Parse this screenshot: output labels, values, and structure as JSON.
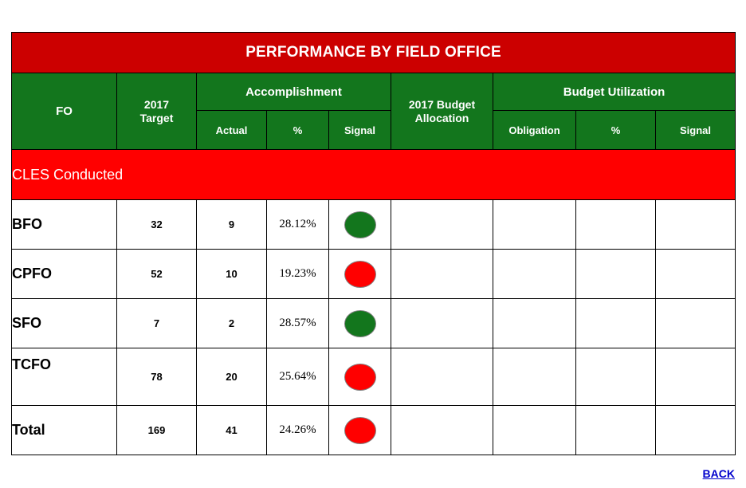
{
  "title": "PERFORMANCE BY FIELD OFFICE",
  "header": {
    "fo": "FO",
    "target": "2017\nTarget",
    "target_line1": "2017",
    "target_line2": "Target",
    "accomplishment": "Accomplishment",
    "actual": "Actual",
    "percent": "%",
    "signal": "Signal",
    "budget_allocation_line1": "2017 Budget",
    "budget_allocation_line2": "Allocation",
    "budget_utilization": "Budget Utilization",
    "obligation": "Obligation",
    "bu_percent": "%",
    "bu_signal": "Signal"
  },
  "section": {
    "label": "CLES Conducted"
  },
  "rows": [
    {
      "fo": "BFO",
      "target": "32",
      "actual": "9",
      "percent": "28.12%",
      "signal": "green",
      "budget_allocation": "",
      "obligation": "",
      "bu_percent": "",
      "bu_signal": ""
    },
    {
      "fo": "CPFO",
      "target": "52",
      "actual": "10",
      "percent": "19.23%",
      "signal": "red",
      "budget_allocation": "",
      "obligation": "",
      "bu_percent": "",
      "bu_signal": ""
    },
    {
      "fo": "SFO",
      "target": "7",
      "actual": "2",
      "percent": "28.57%",
      "signal": "green",
      "budget_allocation": "",
      "obligation": "",
      "bu_percent": "",
      "bu_signal": ""
    },
    {
      "fo": "TCFO",
      "target": "78",
      "actual": "20",
      "percent": "25.64%",
      "signal": "red",
      "budget_allocation": "",
      "obligation": "",
      "bu_percent": "",
      "bu_signal": ""
    },
    {
      "fo": "Total",
      "target": "169",
      "actual": "41",
      "percent": "24.26%",
      "signal": "red",
      "budget_allocation": "",
      "obligation": "",
      "bu_percent": "",
      "bu_signal": ""
    }
  ],
  "footer": {
    "back": "BACK"
  },
  "colors": {
    "title_bar": "#cc0000",
    "header_green": "#13761d",
    "section_red": "#ff0000",
    "signal_green": "#13761d",
    "signal_red": "#ff0000",
    "link": "#0000cc"
  }
}
